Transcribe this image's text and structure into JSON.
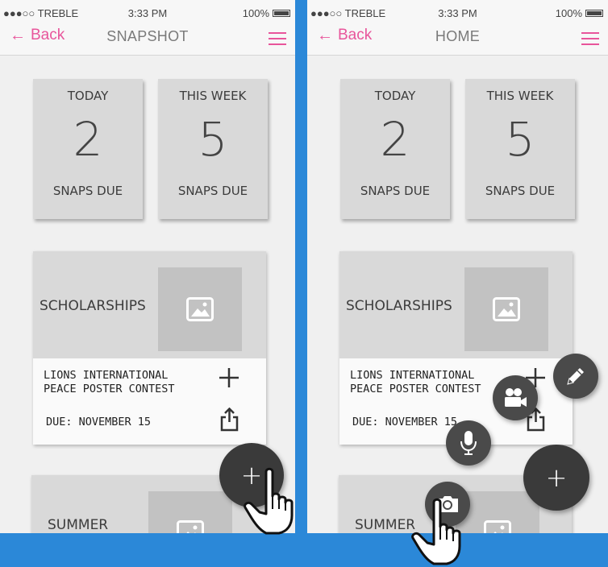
{
  "colors": {
    "accent": "#e8559b",
    "background": "#2b88d8",
    "tile": "#d9d9d9",
    "fab": "#3a3a3a"
  },
  "screens": [
    {
      "status": {
        "carrier": "●●●○○ TREBLE",
        "time": "3:33 PM",
        "battery": "100%"
      },
      "nav": {
        "back": "Back",
        "title": "SNAPSHOT"
      },
      "tiles": [
        {
          "heading": "TODAY",
          "count": "2",
          "footer": "SNAPS DUE"
        },
        {
          "heading": "THIS WEEK",
          "count": "5",
          "footer": "SNAPS DUE"
        }
      ],
      "card": {
        "title": "SCHOLARSHIPS",
        "line1": "LIONS INTERNATIONAL",
        "line2": "PEACE POSTER CONTEST",
        "due": "DUE: NOVEMBER 15"
      },
      "card2": {
        "title": "SUMMER"
      },
      "fab": {
        "label": "+"
      }
    },
    {
      "status": {
        "carrier": "●●●○○ TREBLE",
        "time": "3:33 PM",
        "battery": "100%"
      },
      "nav": {
        "back": "Back",
        "title": "HOME"
      },
      "tiles": [
        {
          "heading": "TODAY",
          "count": "2",
          "footer": "SNAPS DUE"
        },
        {
          "heading": "THIS WEEK",
          "count": "5",
          "footer": "SNAPS DUE"
        }
      ],
      "card": {
        "title": "SCHOLARSHIPS",
        "line1": "LIONS INTERNATIONAL",
        "line2": "PEACE POSTER CONTEST",
        "due": "DUE: NOVEMBER 15"
      },
      "card2": {
        "title": "SUMMER"
      },
      "fab": {
        "label": "+"
      },
      "fab_menu": [
        "pencil-icon",
        "video-camera-icon",
        "microphone-icon",
        "camera-icon"
      ]
    }
  ]
}
